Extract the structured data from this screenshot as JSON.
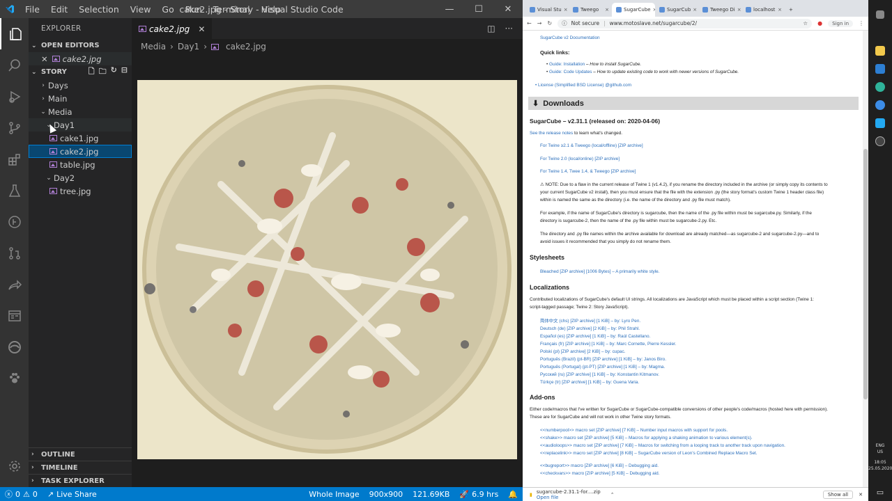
{
  "vscode": {
    "menu": [
      "File",
      "Edit",
      "Selection",
      "View",
      "Go",
      "Run",
      "Terminal",
      "Help"
    ],
    "window_title": "cake2.jpg - Story - Visual Studio Code",
    "sidebar": {
      "title": "EXPLORER",
      "open_editors_label": "OPEN EDITORS",
      "open_editor_file": "cake2.jpg",
      "story_label": "STORY",
      "tree": [
        {
          "label": "Days",
          "chevron": "›",
          "indent": 1
        },
        {
          "label": "Main",
          "chevron": "›",
          "indent": 1
        },
        {
          "label": "Media",
          "chevron": "⌄",
          "indent": 1
        },
        {
          "label": "Day1",
          "chevron": "⌄",
          "indent": 2
        },
        {
          "label": "cake1.jpg",
          "indent": 3,
          "file": true
        },
        {
          "label": "cake2.jpg",
          "indent": 3,
          "file": true,
          "selected": true
        },
        {
          "label": "table.jpg",
          "indent": 3,
          "file": true
        },
        {
          "label": "Day2",
          "chevron": "⌄",
          "indent": 2
        },
        {
          "label": "tree.jpg",
          "indent": 3,
          "file": true
        }
      ],
      "outline_label": "OUTLINE",
      "timeline_label": "TIMELINE",
      "task_explorer_label": "TASK EXPLORER"
    },
    "editor": {
      "tab_label": "cake2.jpg",
      "breadcrumb": [
        "Media",
        "Day1",
        "cake2.jpg"
      ]
    },
    "status": {
      "errors": "0",
      "warnings": "0",
      "live_share": "Live Share",
      "zoom": "Whole Image",
      "dimensions": "900x900",
      "filesize": "121.69KB",
      "time": "6.9 hrs"
    },
    "colors": {
      "accent": "#007acc",
      "selection": "#094771",
      "activity": "#333333"
    }
  },
  "browser": {
    "tabs": [
      "Visual Stu",
      "Tweego",
      "SugarCube",
      "SugarCub",
      "Tweego Di",
      "localhost"
    ],
    "security": "Not secure",
    "url": "www.motoslave.net/sugarcube/2/",
    "signin": "Sign in",
    "page": {
      "doc_link": "SugarCube v2 Documentation",
      "quick_links_label": "Quick links:",
      "quick_links": [
        {
          "link": "Guide: Installation",
          "desc": "– How to install SugarCube."
        },
        {
          "link": "Guide: Code Updates",
          "desc": "– How to update existing code to work with newer versions of SugarCube."
        }
      ],
      "license": "License (Simplified BSD License) @github.com",
      "downloads_heading": "Downloads",
      "release_heading": "SugarCube – v2.31.1 (released on: 2020-04-06)",
      "release_notes_link": "See the release notes",
      "release_notes_rest": "to learn what's changed.",
      "download_links": [
        "For Twine ≥2.1 & Tweego (local/offline) [ZIP archive]",
        "For Twine 2.0 (local/online) [ZIP archive]",
        "For Twine 1.4, Twee 1.4, & Tweego [ZIP archive]"
      ],
      "note_line1": "⚠ NOTE: Due to a flaw in the current release of Twine 1 (v1.4.2), if you rename the directory included in the archive (or simply copy its contents to",
      "note_line2": "your current SugarCube v2 install), then you must ensure that the file with the extension .py (the story format's custom Twine 1 header class file)",
      "note_line3": "within is named the same as the directory (i.e. the name of the directory and .py file must match).",
      "example_line1": "For example, if the name of SugarCube's directory is sugarcube, then the name of the .py file within must be sugarcube.py. Similarly, if the",
      "example_line2": "directory is sugarcube-2, then the name of the .py file within must be sugarcube-2.py. Etc.",
      "matched_line1": "The directory and .py file names within the archive available for download are already matched—as sugarcube-2 and sugarcube-2.py—and to",
      "matched_line2": "avoid issues it recommended that you simply do not rename them.",
      "stylesheets_heading": "Stylesheets",
      "stylesheet_item": "Bleached [ZIP archive] [1006 Bytes] – A primarily white style.",
      "localizations_heading": "Localizations",
      "loc_intro1": "Contributed localizations of SugarCube's default UI strings. All localizations are JavaScript which must be placed within a script section (Twine 1:",
      "loc_intro2": "script-tagged passage; Twine 2: Story JavaScript).",
      "localizations": [
        "简体中文 (chs) [ZIP archive] [1 KiB] – by: Lyro Pen.",
        "Deutsch (de) [ZIP archive] [2 KiB] – by: Phil Strahl.",
        "Español (es) [ZIP archive] [1 KiB] – by: Raúl Castellano.",
        "Français (fr) [ZIP archive] [1 KiB] – by: Marc Cornette, Pierre Kessler.",
        "Polski (pl) [ZIP archive] [2 KiB] – by: cupaс.",
        "Português (Brazil) (pt-BR) [ZIP archive] [1 KiB] – by: Janos Biro.",
        "Português (Portugal) (pt-PT) [ZIP archive] [1 KiB] – by: Magma.",
        "Русский (ru) [ZIP archive] [1 KiB] – by: Konstantin Kitmanov.",
        "Türkçe (tr) [ZIP archive] [1 KiB] – by: Guena Varia."
      ],
      "addons_heading": "Add-ons",
      "addons_intro1": "Either code/macros that I've written for SugarCube or SugarCube-compatible conversions of other people's code/macros (hosted here with permission).",
      "addons_intro2": "These are for SugarCube and will not work in other Twine story formats.",
      "addons": [
        "<<numberpool>> macro set [ZIP archive] [7 KiB] – Number input macros with support for pools.",
        "<<shake>> macro set [ZIP archive] [5 KiB] – Macros for applying a shaking animation to various element(s).",
        "<<audioloops>> macro set [ZIP archive] [7 KiB] – Macros for switching from a looping track to another track upon navigation.",
        "<<replacelink>> macro set [ZIP archive] [8 KiB] – SugarCube version of Leon's Combined Replace Macro Set."
      ],
      "addons2": [
        "<<bugreport>> macro [ZIP archive] [6 KiB] – Debugging aid.",
        "<<checkvars>> macro [ZIP archive] [5 KiB] – Debugging aid."
      ]
    },
    "download": {
      "file": "sugarcube-2.31.1-for....zip",
      "action": "Open file",
      "show_all": "Show all"
    }
  },
  "taskbar": {
    "lang": "ENG",
    "region": "US",
    "time": "18:05",
    "date": "25.05.2020"
  }
}
